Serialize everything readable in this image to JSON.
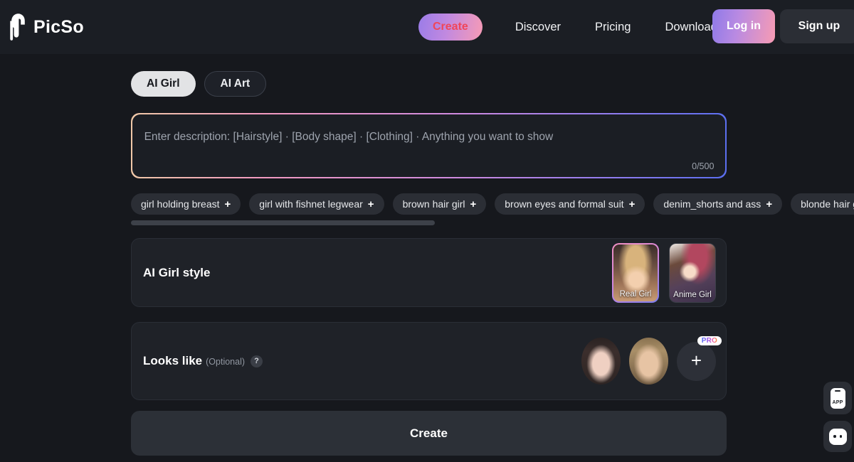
{
  "brand": {
    "name": "PicSo",
    "logo_icon": "paint-drip-logo-icon"
  },
  "nav": {
    "create_label": "Create",
    "links": [
      "Discover",
      "Pricing",
      "Download"
    ],
    "login_label": "Log in",
    "signup_label": "Sign up"
  },
  "tabs": [
    {
      "label": "AI Girl",
      "active": true
    },
    {
      "label": "AI Art",
      "active": false
    }
  ],
  "prompt": {
    "value": "",
    "placeholder": "Enter description: [Hairstyle] · [Body shape] · [Clothing] · Anything you want to show",
    "counter": "0/500"
  },
  "chips": [
    "girl holding breast",
    "girl with fishnet legwear",
    "brown hair girl",
    "brown eyes and formal suit",
    "denim_shorts and ass",
    "blonde hair girl"
  ],
  "chip_add_glyph": "+",
  "style_section": {
    "label": "AI Girl style",
    "options": [
      {
        "label": "Real Girl",
        "selected": true
      },
      {
        "label": "Anime Girl",
        "selected": false
      }
    ]
  },
  "looks_like_section": {
    "label": "Looks like",
    "optional": "(Optional)",
    "help_glyph": "?",
    "add_glyph": "+",
    "pro_badge": "PRO",
    "avatars": [
      "asian-female-face",
      "blonde-female-face"
    ]
  },
  "create_button": {
    "label": "Create"
  },
  "floating": {
    "app_label": "APP",
    "chat_icon": "chat-bubble-icon"
  },
  "colors": {
    "page_bg": "#16181d",
    "header_bg": "#1b1e24",
    "panel_bg": "#1f2228",
    "accent_pink": "#f79bb5",
    "accent_purple": "#8f7ae8",
    "create_text": "#f0465a"
  }
}
